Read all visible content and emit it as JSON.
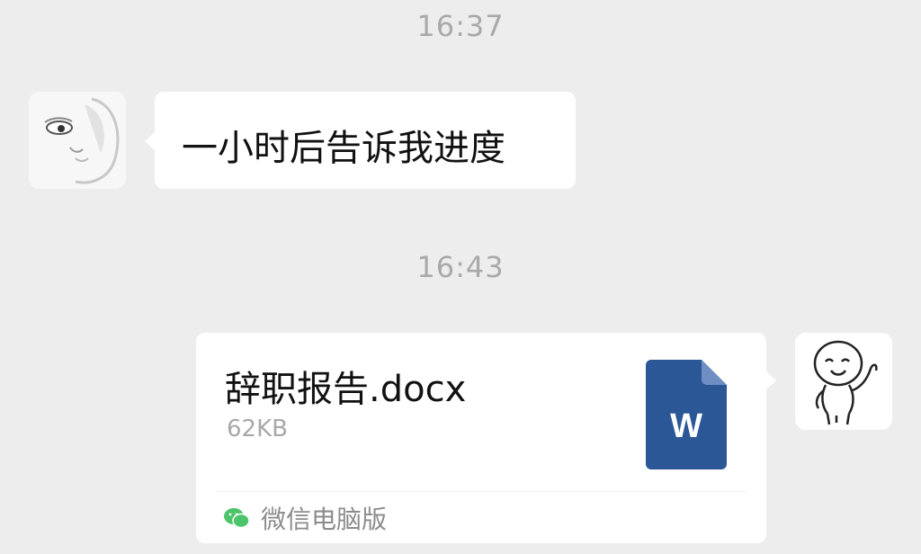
{
  "chat": {
    "timestamps": [
      "16:37",
      "16:43"
    ],
    "incoming_message": {
      "text": "一小时后告诉我进度",
      "avatar": "sketched-face-avatar"
    },
    "outgoing_file": {
      "file_name": "辞职报告.docx",
      "file_size": "62KB",
      "file_icon": "word-document-icon",
      "file_icon_letter": "W",
      "source_label": "微信电脑版",
      "source_icon": "wechat-icon",
      "avatar": "doodle-figure-avatar"
    }
  },
  "colors": {
    "background": "#ededed",
    "bubble": "#ffffff",
    "word_blue": "#2b5797",
    "wechat_green": "#4cc46a"
  }
}
